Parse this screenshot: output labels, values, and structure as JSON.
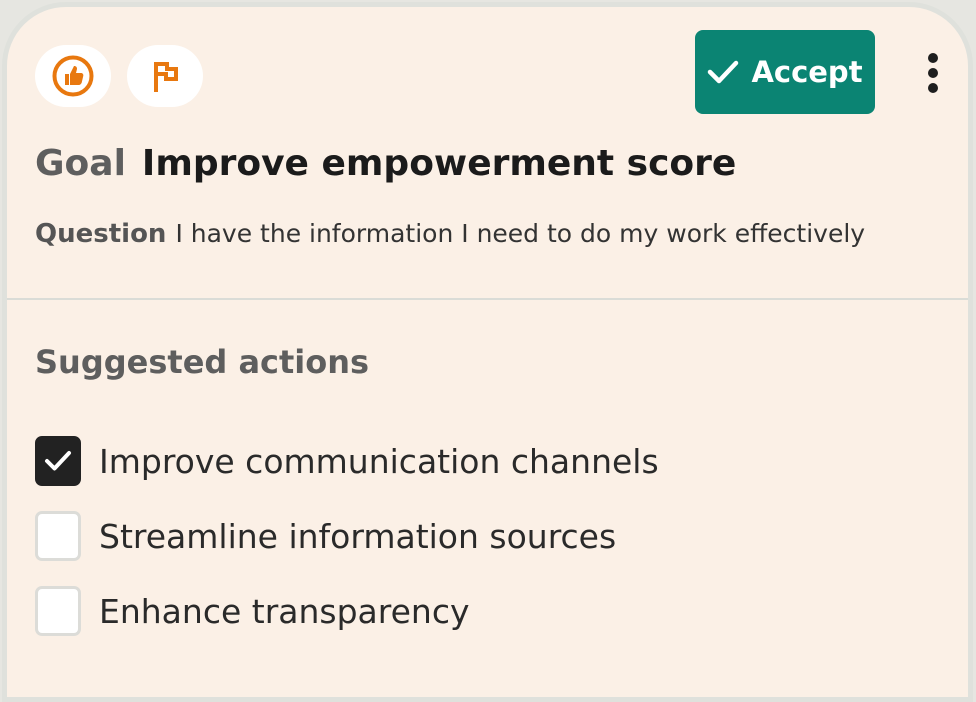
{
  "header": {
    "icons": [
      "thumbs-up-icon",
      "flag-icon"
    ],
    "accept_label": "Accept",
    "accent_color": "#0b8473",
    "icon_color": "#e8780f"
  },
  "goal": {
    "label": "Goal",
    "title": "Improve empowerment score"
  },
  "question": {
    "label": "Question",
    "text": "I have the information I need to do my work effectively"
  },
  "suggested_actions": {
    "title": "Suggested actions",
    "items": [
      {
        "label": "Improve communication channels",
        "checked": true
      },
      {
        "label": "Streamline information sources",
        "checked": false
      },
      {
        "label": "Enhance transparency",
        "checked": false
      }
    ]
  }
}
